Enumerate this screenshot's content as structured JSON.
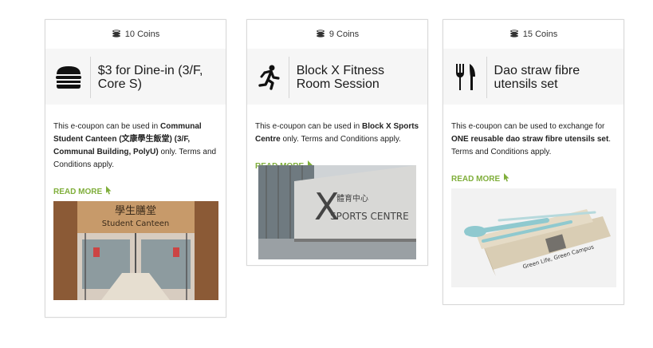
{
  "cards": [
    {
      "coins": "10 Coins",
      "icon": "burger-icon",
      "title": "$3 for Dine-in (3/F, Core S)",
      "desc_pre": "This e-coupon can be used in ",
      "desc_bold": "Communal Student Canteen (文康學生飯堂) (3/F, Communal Building, PolyU)",
      "desc_post": " only. Terms and Conditions apply.",
      "read_more": "READ MORE",
      "photo_sign_cn": "學生膳堂",
      "photo_sign_en": "Student Canteen"
    },
    {
      "coins": "9 Coins",
      "icon": "running-person-icon",
      "title": "Block X Fitness Room Session",
      "desc_pre": "This e-coupon can be used in ",
      "desc_bold": "Block X Sports Centre",
      "desc_post": " only. Terms and Conditions apply.",
      "read_more": "READ MORE",
      "photo_sign_letter": "X",
      "photo_sign_cn": "體育中心",
      "photo_sign_en": "SPORTS CENTRE"
    },
    {
      "coins": "15 Coins",
      "icon": "utensils-icon",
      "title": "Dao straw fibre utensils set",
      "desc_pre": "This e-coupon can be used to exchange for ",
      "desc_bold": "ONE reusable dao straw fibre utensils set",
      "desc_post": ". Terms and Conditions apply.",
      "read_more": "READ MORE",
      "photo_box_text": "Green Life, Green Campus"
    }
  ],
  "colors": {
    "accent": "#7fae3a",
    "border": "#d9d9d9"
  }
}
